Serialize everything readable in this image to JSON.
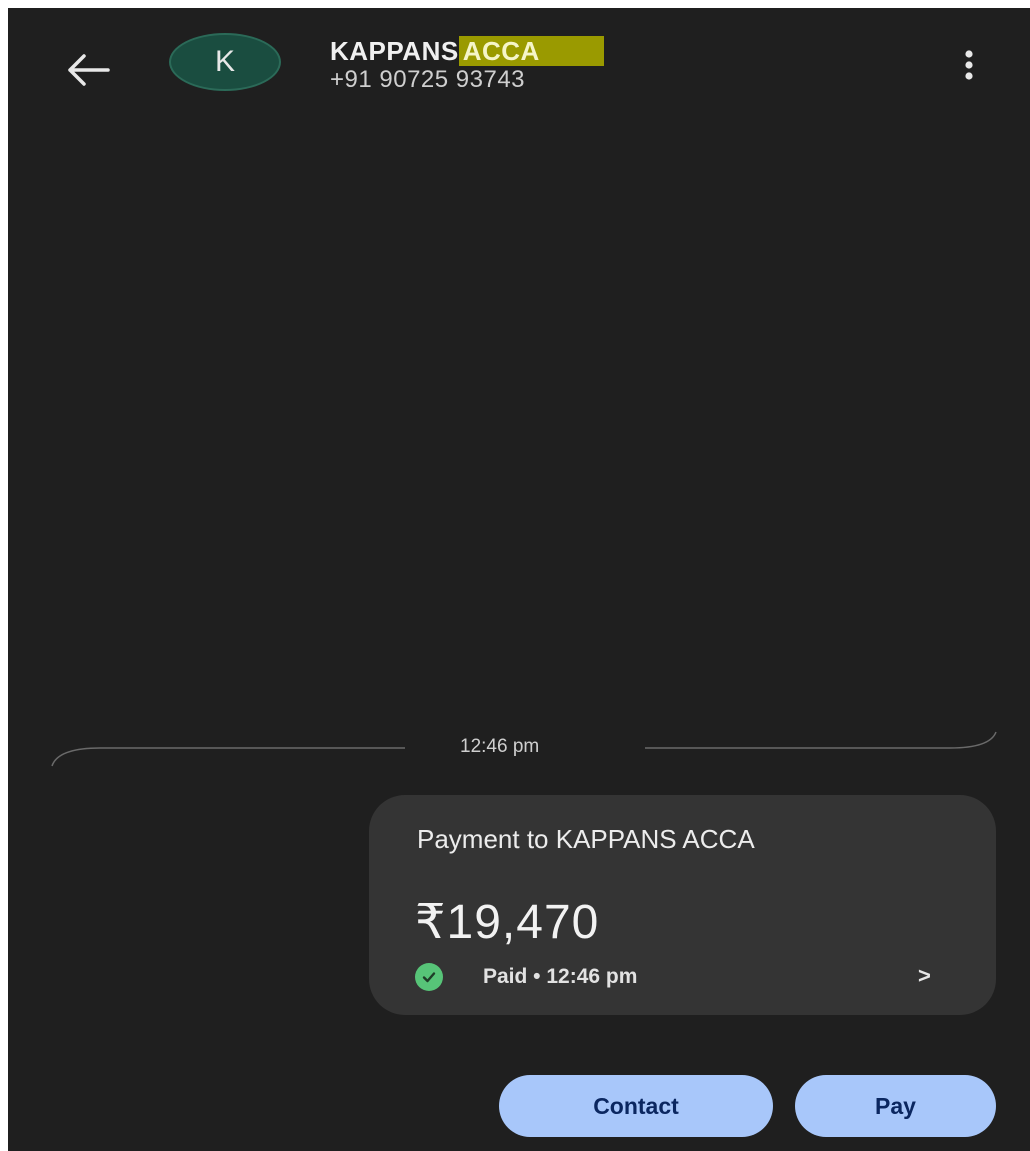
{
  "header": {
    "back_icon": "arrow-left-icon",
    "avatar_letter": "K",
    "contact_name_main": "KAPPANS",
    "contact_name_highlight": "ACCA",
    "phone": "+91 90725 93743",
    "menu_icon": "more-vertical-icon"
  },
  "conversation": {
    "time_separator": "12:46 pm",
    "payment_card": {
      "title": "Payment to KAPPANS ACCA",
      "amount": "₹19,470",
      "status_icon": "check-circle-icon",
      "status": "Paid • 12:46 pm",
      "chevron": ">"
    }
  },
  "actions": {
    "contact_label": "Contact",
    "pay_label": "Pay"
  },
  "colors": {
    "background": "#1f1f1f",
    "card": "#343434",
    "avatar": "#1a4d40",
    "highlight": "#9a9a00",
    "button": "#a8c7fa",
    "button_text": "#0b2760",
    "success": "#57c478"
  }
}
